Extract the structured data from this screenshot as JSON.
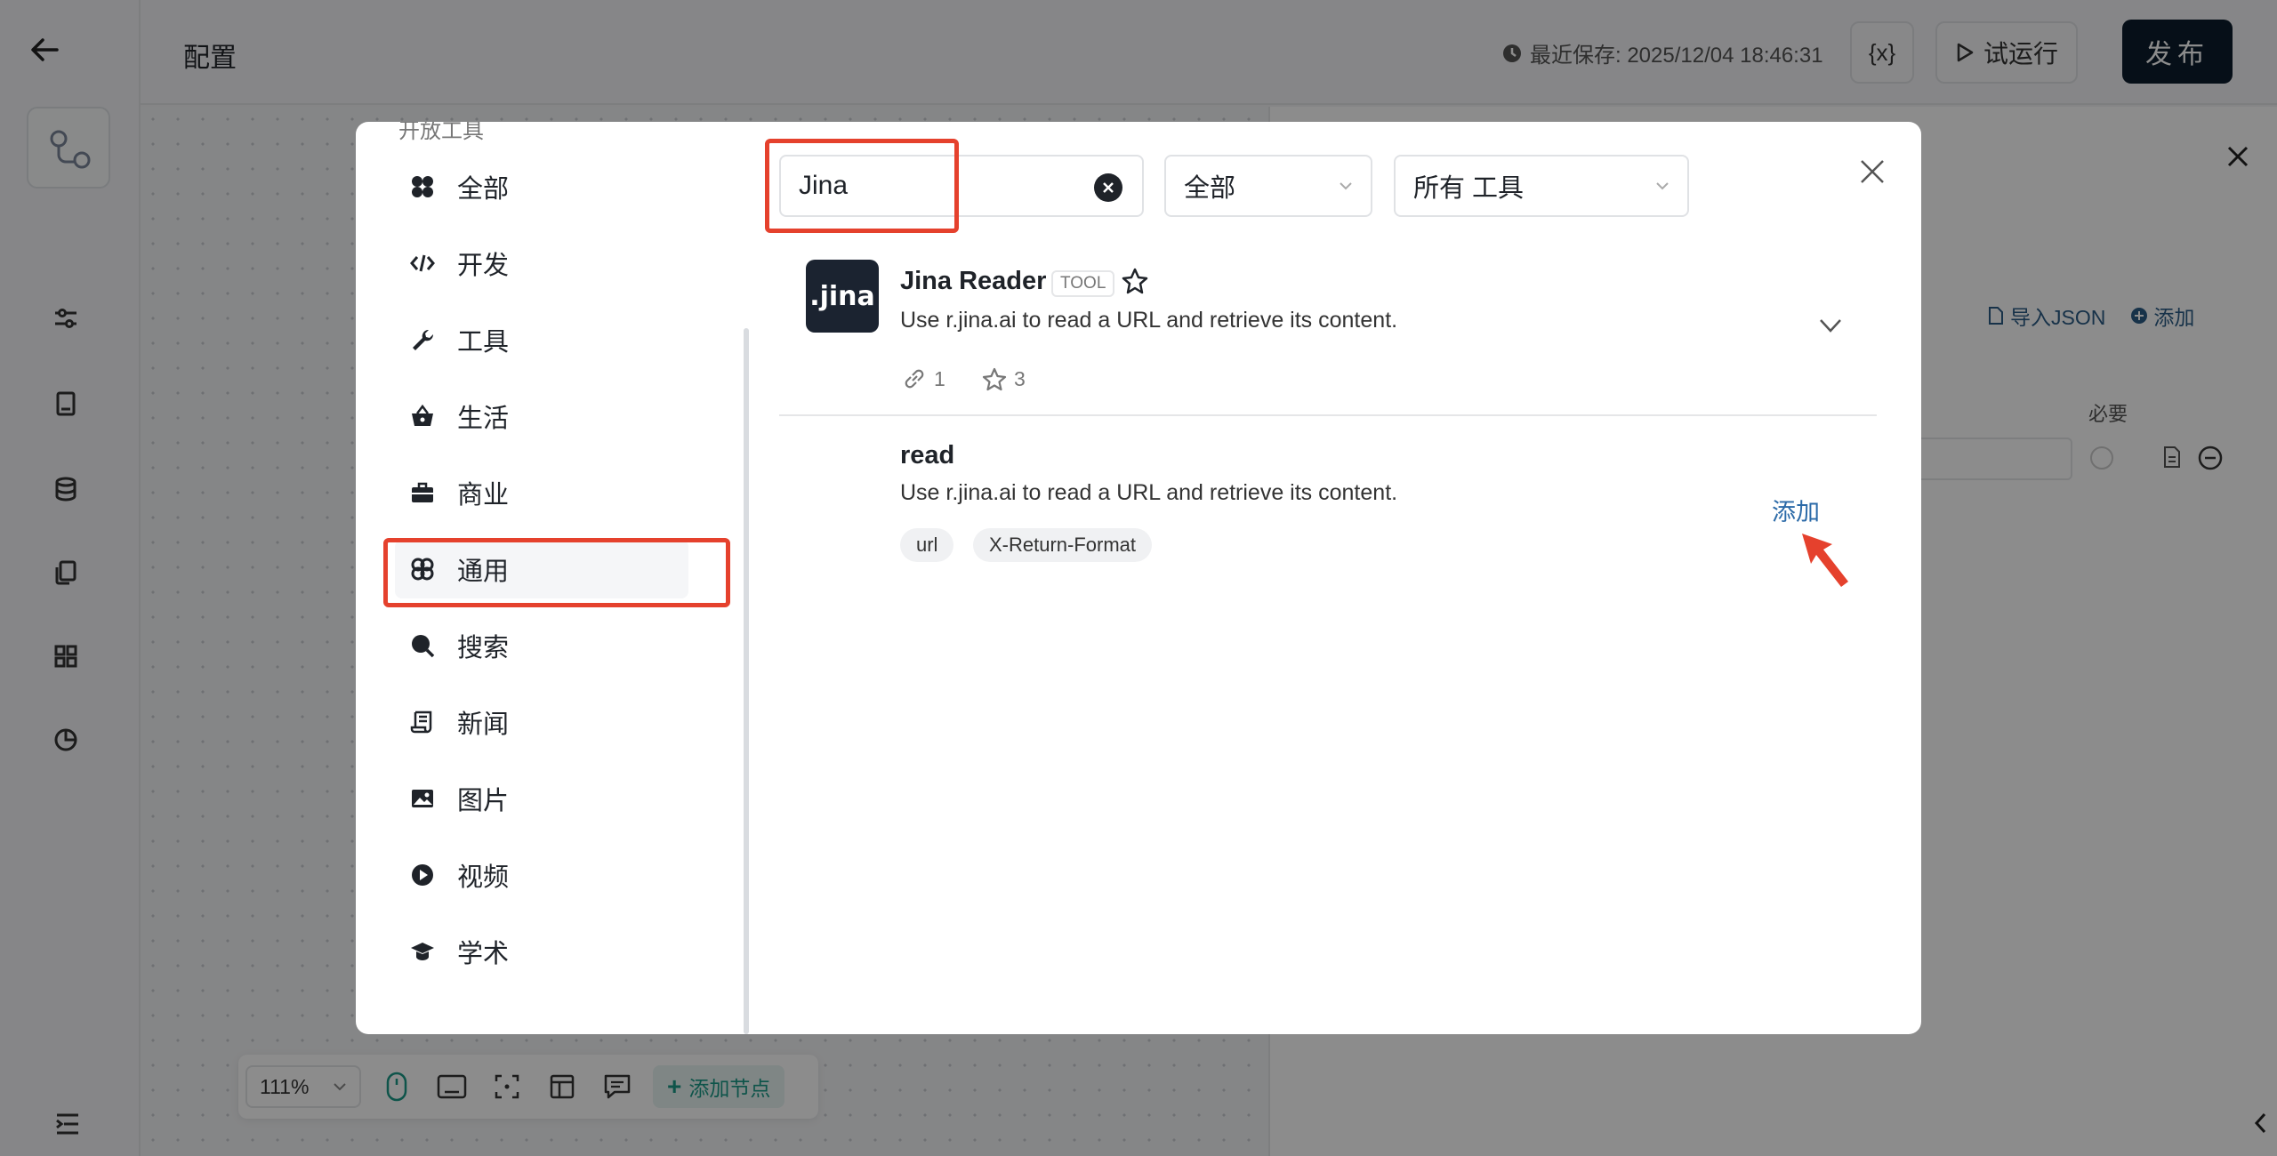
{
  "header": {
    "title": "配置",
    "save_info": "最近保存: 2025/12/04 18:46:31",
    "var_label": "{x}",
    "run_label": "试运行",
    "publish_label": "发布"
  },
  "right_panel": {
    "import_json": "导入JSON",
    "add": "添加",
    "required": "必要"
  },
  "toolbar": {
    "zoom": "111%",
    "add_node": "添加节点"
  },
  "modal": {
    "category_header": "开放工具",
    "categories": [
      {
        "label": "全部",
        "icon": "grid-icon"
      },
      {
        "label": "开发",
        "icon": "code-icon"
      },
      {
        "label": "工具",
        "icon": "wrench-icon"
      },
      {
        "label": "生活",
        "icon": "basket-icon"
      },
      {
        "label": "商业",
        "icon": "briefcase-icon"
      },
      {
        "label": "通用",
        "icon": "atom-icon"
      },
      {
        "label": "搜索",
        "icon": "search-icon"
      },
      {
        "label": "新闻",
        "icon": "scroll-icon"
      },
      {
        "label": "图片",
        "icon": "image-icon"
      },
      {
        "label": "视频",
        "icon": "play-icon"
      },
      {
        "label": "学术",
        "icon": "graduation-cap-icon"
      }
    ],
    "selected_category": "通用",
    "search": {
      "value": "Jina"
    },
    "filter_scope": "全部",
    "filter_type": "所有 工具",
    "tool": {
      "logo_text": ".jina",
      "name": "Jina Reader",
      "badge": "TOOL",
      "description": "Use r.jina.ai to read a URL and retrieve its content.",
      "usage_count": "1",
      "star_count": "3"
    },
    "function": {
      "name": "read",
      "description": "Use r.jina.ai to read a URL and retrieve its content.",
      "params": [
        "url",
        "X-Return-Format"
      ],
      "add_label": "添加"
    }
  },
  "colors": {
    "highlight": "#e5412d",
    "accent_teal": "#1a9a87",
    "link_blue": "#2b6aa8",
    "publish_bg": "#0b1d2c"
  }
}
